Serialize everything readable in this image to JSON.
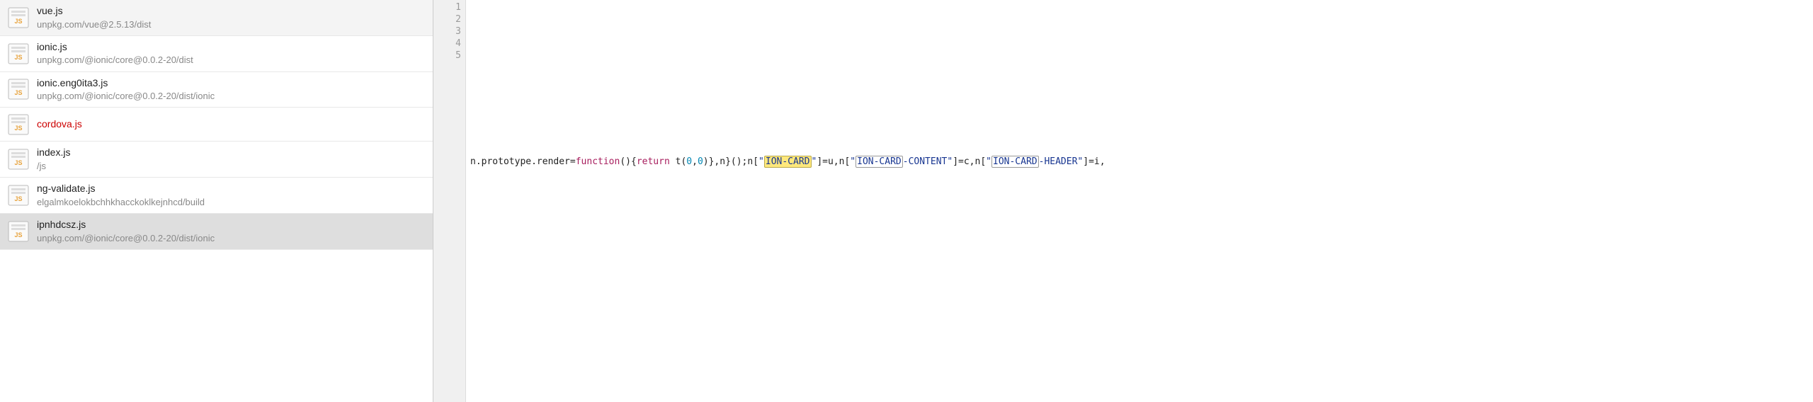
{
  "sidebar": {
    "items": [
      {
        "name": "vue.js",
        "path": "unpkg.com/vue@2.5.13/dist",
        "error": false,
        "selected": false,
        "dim": true
      },
      {
        "name": "ionic.js",
        "path": "unpkg.com/@ionic/core@0.0.2-20/dist",
        "error": false,
        "selected": false,
        "dim": false
      },
      {
        "name": "ionic.eng0ita3.js",
        "path": "unpkg.com/@ionic/core@0.0.2-20/dist/ionic",
        "error": false,
        "selected": false,
        "dim": false
      },
      {
        "name": "cordova.js",
        "path": "",
        "error": true,
        "selected": false,
        "dim": false
      },
      {
        "name": "index.js",
        "path": "/js",
        "error": false,
        "selected": false,
        "dim": false
      },
      {
        "name": "ng-validate.js",
        "path": "elgalmkoelokbchhkhacckoklkejnhcd/build",
        "error": false,
        "selected": false,
        "dim": false
      },
      {
        "name": "ipnhdcsz.js",
        "path": "unpkg.com/@ionic/core@0.0.2-20/dist/ionic",
        "error": false,
        "selected": true,
        "dim": false
      }
    ]
  },
  "gutter": {
    "lines": [
      "1",
      "2",
      "3",
      "4",
      "5"
    ]
  },
  "code": {
    "seg_pre": "n.prototype.render=",
    "seg_func": "function",
    "seg_paren1": "(){",
    "seg_return": "return",
    "seg_call": " t(",
    "seg_zero1": "0",
    "seg_comma": ",",
    "seg_zero2": "0",
    "seg_after": ")},n}();n[",
    "seg_q1a": "\"",
    "seg_ioncard": "ION-CARD",
    "seg_q1b": "\"",
    "seg_mid1": "]=u,n[",
    "seg_q2a": "\"",
    "seg_ioncard2": "ION-CARD",
    "seg_content": "-CONTENT",
    "seg_q2b": "\"",
    "seg_mid2": "]=c,n[",
    "seg_q3a": "\"",
    "seg_ioncard3": "ION-CARD",
    "seg_header": "-HEADER",
    "seg_q3b": "\"",
    "seg_mid3": "]=i,"
  },
  "icons": {
    "js_label": "JS"
  }
}
